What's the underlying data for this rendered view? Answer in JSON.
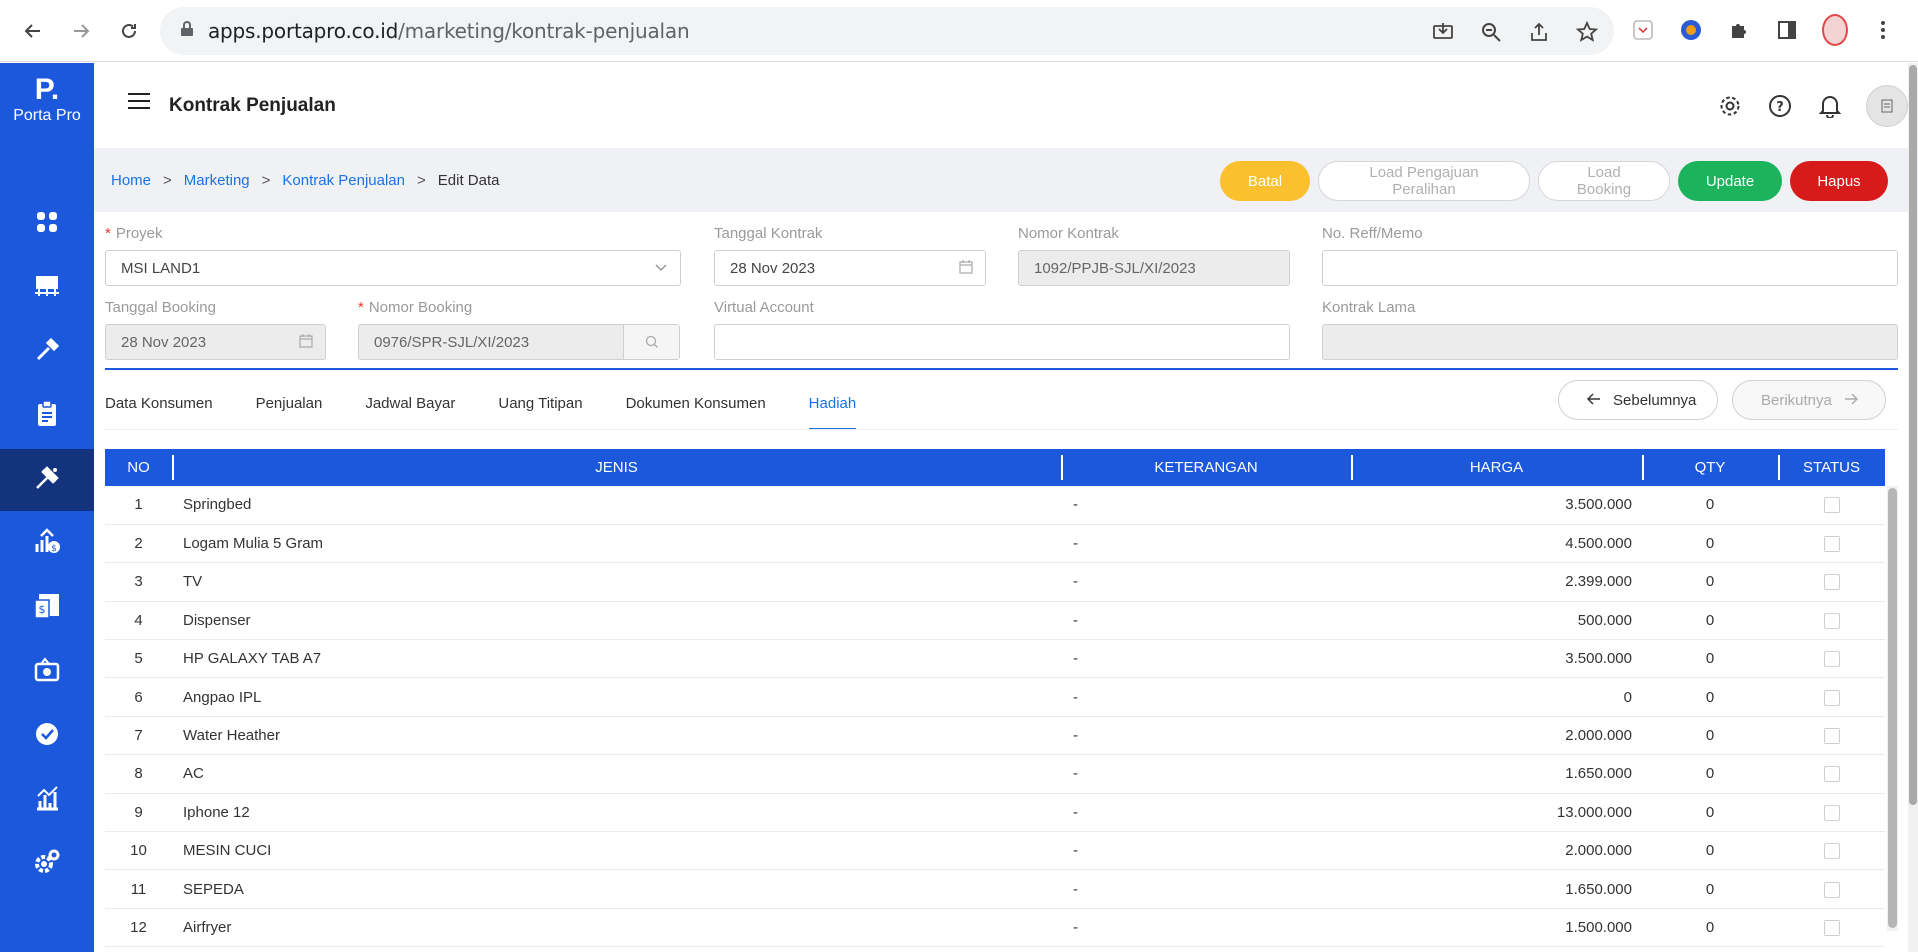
{
  "browser": {
    "url_domain": "apps.portapro.co.id",
    "url_path": "/marketing/kontrak-penjualan"
  },
  "brand": {
    "mark": "P.",
    "name": "Porta Pro"
  },
  "sidebar": {
    "items": [
      "dashboard-icon",
      "inventory-icon",
      "tools-icon",
      "clipboard-icon",
      "marketing-icon",
      "finance-icon",
      "invoice-icon",
      "money-icon",
      "verified-icon",
      "report-icon",
      "settings-icon"
    ],
    "active_index": 4
  },
  "header": {
    "title": "Kontrak Penjualan"
  },
  "breadcrumb": {
    "home": "Home",
    "marketing": "Marketing",
    "kontrak": "Kontrak Penjualan",
    "current": "Edit Data",
    "sep": ">"
  },
  "actions": {
    "batal": "Batal",
    "load_pengajuan": "Load Pengajuan Peralihan",
    "load_booking": "Load Booking",
    "update": "Update",
    "hapus": "Hapus"
  },
  "form": {
    "proyek": {
      "label": "Proyek",
      "value": "MSI LAND1"
    },
    "tanggal_kontrak": {
      "label": "Tanggal Kontrak",
      "value": "28 Nov 2023"
    },
    "nomor_kontrak": {
      "label": "Nomor Kontrak",
      "value": "1092/PPJB-SJL/XI/2023"
    },
    "no_reff": {
      "label": "No. Reff/Memo",
      "value": ""
    },
    "tanggal_booking": {
      "label": "Tanggal Booking",
      "value": "28 Nov 2023"
    },
    "nomor_booking": {
      "label": "Nomor Booking",
      "value": "0976/SPR-SJL/XI/2023"
    },
    "virtual_account": {
      "label": "Virtual Account",
      "value": ""
    },
    "kontrak_lama": {
      "label": "Kontrak Lama",
      "value": ""
    }
  },
  "tabs": [
    "Data Konsumen",
    "Penjualan",
    "Jadwal Bayar",
    "Uang Titipan",
    "Dokumen Konsumen",
    "Hadiah"
  ],
  "active_tab": "Hadiah",
  "pager": {
    "prev": "Sebelumnya",
    "next": "Berikutnya"
  },
  "table": {
    "headers": {
      "no": "NO",
      "jenis": "JENIS",
      "keterangan": "KETERANGAN",
      "harga": "HARGA",
      "qty": "QTY",
      "status": "STATUS"
    },
    "rows": [
      {
        "no": "1",
        "jenis": "Springbed",
        "keterangan": "-",
        "harga": "3.500.000",
        "qty": "0",
        "status": false
      },
      {
        "no": "2",
        "jenis": "Logam Mulia 5 Gram",
        "keterangan": "-",
        "harga": "4.500.000",
        "qty": "0",
        "status": false
      },
      {
        "no": "3",
        "jenis": "TV",
        "keterangan": "-",
        "harga": "2.399.000",
        "qty": "0",
        "status": false
      },
      {
        "no": "4",
        "jenis": "Dispenser",
        "keterangan": "-",
        "harga": "500.000",
        "qty": "0",
        "status": false
      },
      {
        "no": "5",
        "jenis": "HP GALAXY TAB A7",
        "keterangan": "-",
        "harga": "3.500.000",
        "qty": "0",
        "status": false
      },
      {
        "no": "6",
        "jenis": "Angpao IPL",
        "keterangan": "-",
        "harga": "0",
        "qty": "0",
        "status": false
      },
      {
        "no": "7",
        "jenis": "Water Heather",
        "keterangan": "-",
        "harga": "2.000.000",
        "qty": "0",
        "status": false
      },
      {
        "no": "8",
        "jenis": "AC",
        "keterangan": "-",
        "harga": "1.650.000",
        "qty": "0",
        "status": false
      },
      {
        "no": "9",
        "jenis": "Iphone 12",
        "keterangan": "-",
        "harga": "13.000.000",
        "qty": "0",
        "status": false
      },
      {
        "no": "10",
        "jenis": "MESIN CUCI",
        "keterangan": "-",
        "harga": "2.000.000",
        "qty": "0",
        "status": false
      },
      {
        "no": "11",
        "jenis": "SEPEDA",
        "keterangan": "-",
        "harga": "1.650.000",
        "qty": "0",
        "status": false
      },
      {
        "no": "12",
        "jenis": "Airfryer",
        "keterangan": "-",
        "harga": "1.500.000",
        "qty": "0",
        "status": false
      }
    ]
  },
  "colors": {
    "primary": "#1c58dc",
    "sidebar_active": "#14337f",
    "batal": "#fbc02d",
    "update": "#1bb45d",
    "hapus": "#d71a1a",
    "link": "#1a73e8"
  }
}
